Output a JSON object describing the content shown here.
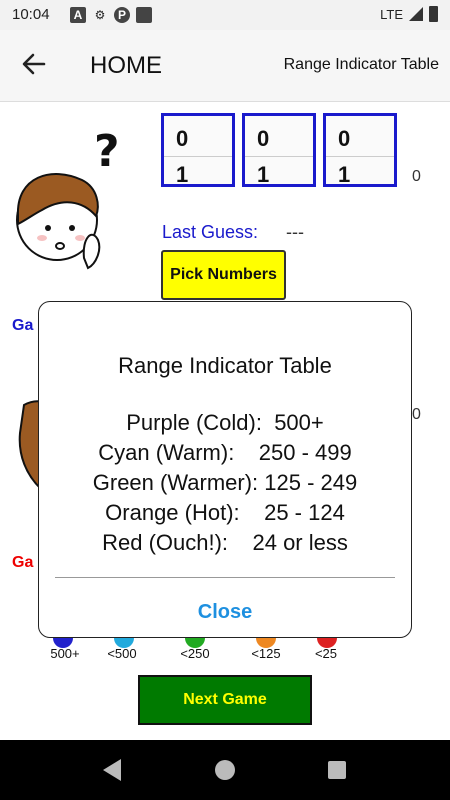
{
  "status_bar": {
    "time": "10:04",
    "network": "LTE",
    "icons": [
      "a-icon",
      "gear-icon",
      "p-icon",
      "sd-card-icon"
    ]
  },
  "app_bar": {
    "title": "HOME",
    "action_label": "Range Indicator Table"
  },
  "game": {
    "digits": [
      {
        "top": "0",
        "bottom": "1"
      },
      {
        "top": "0",
        "bottom": "1"
      },
      {
        "top": "0",
        "bottom": "1"
      }
    ],
    "count_a": "0",
    "count_b": "0",
    "last_guess_label": "Last Guess:",
    "last_guess_value": "---",
    "pick_button": "Pick Numbers",
    "game_label_blue": "Ga",
    "game_label_red": "Ga",
    "next_button": "Next Game"
  },
  "legend": [
    {
      "label": "500+",
      "color": "#2222cc"
    },
    {
      "label": "<500",
      "color": "#22aadd"
    },
    {
      "label": "<250",
      "color": "#22aa22"
    },
    {
      "label": "<125",
      "color": "#ee8822"
    },
    {
      "label": "<25",
      "color": "#dd2222"
    }
  ],
  "dialog": {
    "title": "Range Indicator Table",
    "rows": [
      "Purple (Cold):  500+",
      "Cyan (Warm):    250 - 499",
      "Green (Warmer): 125 - 249",
      "Orange (Hot):    25 - 124",
      "Red (Ouch!):    24 or less"
    ],
    "close_label": "Close"
  }
}
